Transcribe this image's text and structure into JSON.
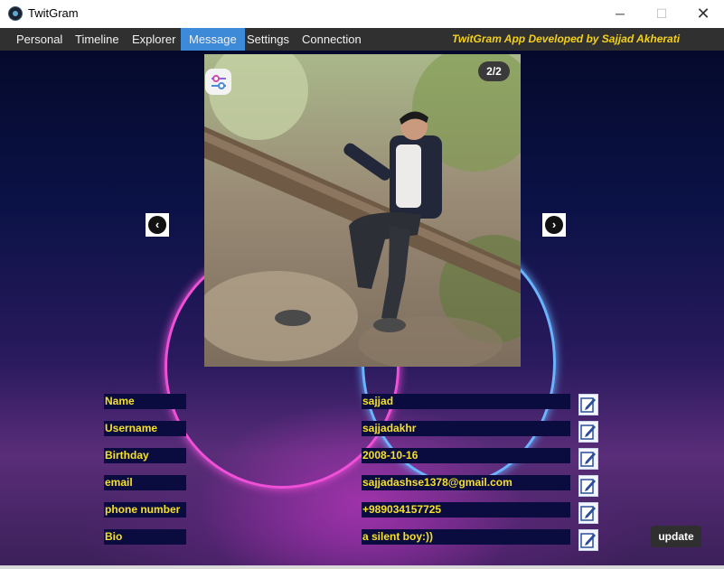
{
  "window": {
    "title": "TwitGram",
    "minimize_glyph": "─",
    "maximize_glyph": "☐",
    "close_glyph": "✕"
  },
  "menu": {
    "items": [
      {
        "label": "Personal"
      },
      {
        "label": "Timeline"
      },
      {
        "label": "Explorer"
      },
      {
        "label": "Message",
        "active": true
      },
      {
        "label": "Settings"
      },
      {
        "label": "Connection"
      }
    ],
    "credit": "TwitGram App Developed by Sajjad Akherati"
  },
  "gallery": {
    "counter": "2/2",
    "prev_icon": "chevron-left-icon",
    "next_icon": "chevron-right-icon",
    "prev_glyph": "‹",
    "next_glyph": "›",
    "filter_icon": "sliders-icon"
  },
  "profile": {
    "fields": [
      {
        "label": "Name",
        "value": "sajjad"
      },
      {
        "label": "Username",
        "value": "sajjadakhr"
      },
      {
        "label": "Birthday",
        "value": "2008-10-16"
      },
      {
        "label": "email",
        "value": "sajjadashse1378@gmail.com"
      },
      {
        "label": "phone number",
        "value": "+989034157725"
      },
      {
        "label": "Bio",
        "value": "a silent boy:))"
      }
    ],
    "edit_icon": "edit-pencil-icon",
    "update_label": "update"
  },
  "colors": {
    "menu_bg": "#303030",
    "menu_active": "#3d8ad8",
    "credit_text": "#f2d01c",
    "field_bg": "#0a0c40",
    "field_text": "#f5e02a",
    "ring_pink": "#f04fd8",
    "ring_blue": "#6ab4ff"
  }
}
